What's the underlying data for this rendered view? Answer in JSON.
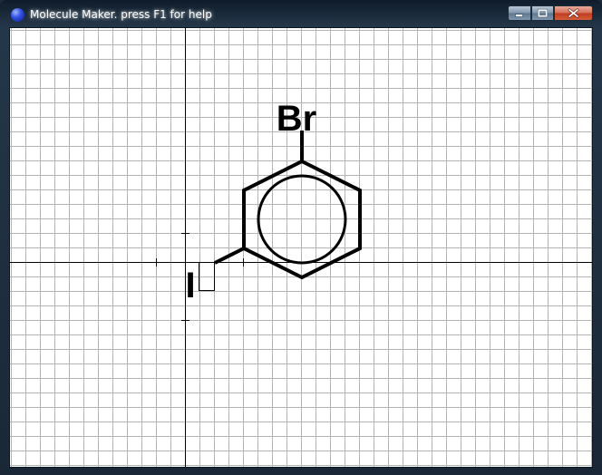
{
  "window": {
    "title": "Molecule Maker. press  F1 for help",
    "app_icon": "blue-sphere-icon",
    "controls": {
      "minimize_icon": "minimize-icon",
      "maximize_icon": "maximize-icon",
      "close_icon": "close-icon"
    }
  },
  "canvas": {
    "background": "#ffffff",
    "grid_color": "#b4b4b4",
    "axis_color": "#000000",
    "bond_color": "#000000",
    "grid": true
  },
  "molecule": {
    "atoms": [
      {
        "label": "Br"
      },
      {
        "label": "I"
      }
    ],
    "ring": "benzene",
    "aromatic_circle": true
  },
  "colors": {
    "title_text": "#ffffff",
    "close_button": "#c9452a",
    "frame": "#1f3346"
  }
}
